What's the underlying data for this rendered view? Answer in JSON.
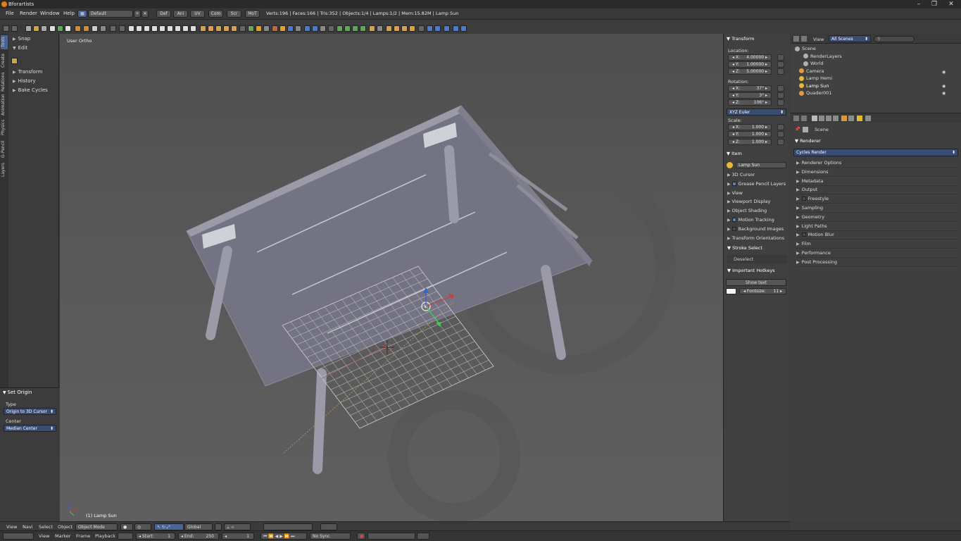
{
  "window": {
    "title": "Bforartists"
  },
  "menu": [
    "File",
    "Render",
    "Window",
    "Help"
  ],
  "screen_layout": "Default",
  "workspace_tabs": [
    "Def",
    "Ani",
    "UV",
    "Com",
    "Scr",
    "MoT"
  ],
  "stats": "Verts:196 | Faces:166 | Tris:352 | Objects:1/4 | Lamps:1/2 | Mem:15.82M | Lamp Sun",
  "left_tabs": [
    "Tools",
    "Create",
    "Relations",
    "Animation",
    "Physics",
    "G-Pencil",
    "Layers"
  ],
  "toolshelf": {
    "items": [
      "Snap",
      "Edit",
      "Transform",
      "History",
      "Bake Cycles"
    ]
  },
  "set_origin": {
    "title": "Set Origin",
    "type_label": "Type",
    "type_value": "Origin to 3D Cursor",
    "center_label": "Center",
    "center_value": "Median Center"
  },
  "viewport": {
    "view_label": "User Ortho",
    "object_label": "(1) Lamp Sun"
  },
  "npanel": {
    "transform_title": "Transform",
    "location_label": "Location:",
    "location": [
      {
        "axis": "X:",
        "value": "4.00000"
      },
      {
        "axis": "Y:",
        "value": "1.00000"
      },
      {
        "axis": "Z:",
        "value": "5.00000"
      }
    ],
    "rotation_label": "Rotation:",
    "rotation": [
      {
        "axis": "X:",
        "value": "37°"
      },
      {
        "axis": "Y:",
        "value": "3°"
      },
      {
        "axis": "Z:",
        "value": "106°"
      }
    ],
    "rotation_mode": "XYZ Euler",
    "scale_label": "Scale:",
    "scale": [
      {
        "axis": "X:",
        "value": "1.000"
      },
      {
        "axis": "Y:",
        "value": "1.000"
      },
      {
        "axis": "Z:",
        "value": "1.000"
      }
    ],
    "item_title": "Item",
    "item_name": "Lamp Sun",
    "sections": [
      {
        "label": "3D Cursor",
        "check": null
      },
      {
        "label": "Grease Pencil Layers",
        "check": true
      },
      {
        "label": "View",
        "check": null
      },
      {
        "label": "Viewport Display",
        "check": null
      },
      {
        "label": "Object Shading",
        "check": null
      },
      {
        "label": "Motion Tracking",
        "check": true
      },
      {
        "label": "Background Images",
        "check": false
      },
      {
        "label": "Transform Orientations",
        "check": null
      }
    ],
    "stroke_select_title": "Stroke Select",
    "deselect_label": "Deselect",
    "hotkeys_title": "Important Hotkeys",
    "show_text_label": "Show text",
    "fontsize_label": "Fontsize:",
    "fontsize_value": "11"
  },
  "outliner": {
    "view_label": "View",
    "scenes_dropdown": "All Scenes",
    "items": [
      {
        "label": "Scene",
        "color": "#b0b0b0"
      },
      {
        "label": "RenderLayers",
        "color": "#b0b0b0"
      },
      {
        "label": "World",
        "color": "#b0b0b0"
      },
      {
        "label": "Camera",
        "color": "#e59a3b"
      },
      {
        "label": "Lamp Hemi",
        "color": "#e5b83b"
      },
      {
        "label": "Lamp Sun",
        "color": "#e5b83b"
      },
      {
        "label": "Quader001",
        "color": "#e59a3b"
      }
    ]
  },
  "properties": {
    "scene_label": "Scene",
    "renderer_title": "Renderer",
    "render_engine": "Cycles Render",
    "panels": [
      {
        "label": "Renderer Options",
        "check": null
      },
      {
        "label": "Dimensions",
        "check": null
      },
      {
        "label": "Metadata",
        "check": null
      },
      {
        "label": "Output",
        "check": null
      },
      {
        "label": "Freestyle",
        "check": false
      },
      {
        "label": "Sampling",
        "check": null
      },
      {
        "label": "Geometry",
        "check": null
      },
      {
        "label": "Light Paths",
        "check": null
      },
      {
        "label": "Motion Blur",
        "check": false
      },
      {
        "label": "Film",
        "check": null
      },
      {
        "label": "Performance",
        "check": null
      },
      {
        "label": "Post Processing",
        "check": null
      }
    ]
  },
  "viewport_header": {
    "menus": [
      "View",
      "Navi",
      "Select",
      "Object"
    ],
    "mode": "Object Mode",
    "orientation": "Global"
  },
  "timeline": {
    "menus": [
      "View",
      "Marker",
      "Frame",
      "Playback"
    ],
    "start_label": "Start:",
    "start_value": "1",
    "end_label": "End:",
    "end_value": "250",
    "current_frame": "1",
    "sync": "No Sync"
  }
}
